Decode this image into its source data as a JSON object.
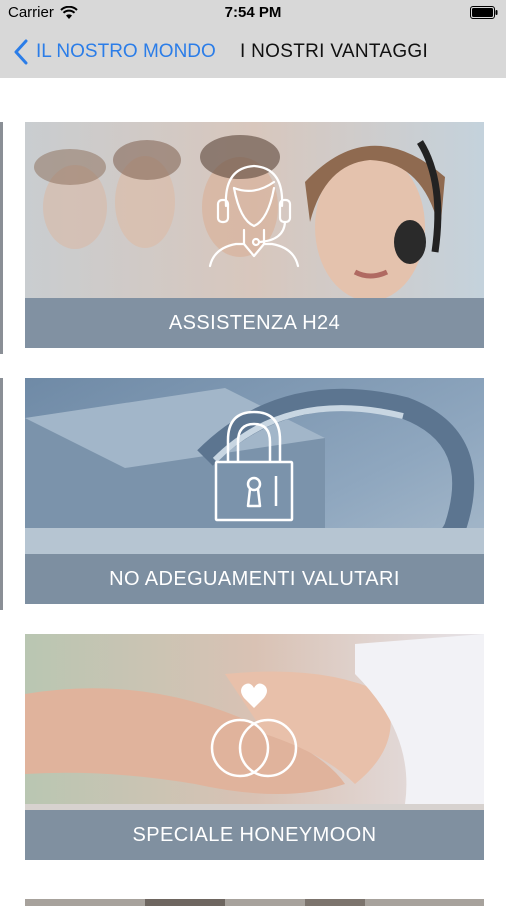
{
  "status_bar": {
    "carrier": "Carrier",
    "time": "7:54 PM"
  },
  "nav": {
    "back_label": "IL NOSTRO MONDO",
    "title": "I NOSTRI VANTAGGI"
  },
  "cards": [
    {
      "label": "ASSISTENZA H24",
      "icon": "headset-agent-icon"
    },
    {
      "label": "NO ADEGUAMENTI VALUTARI",
      "icon": "padlock-icon"
    },
    {
      "label": "SPECIALE HONEYMOON",
      "icon": "wedding-rings-icon"
    }
  ],
  "colors": {
    "accent": "#2b7de8",
    "label_band": "#788a9c",
    "bars": "#d8d8d8"
  }
}
